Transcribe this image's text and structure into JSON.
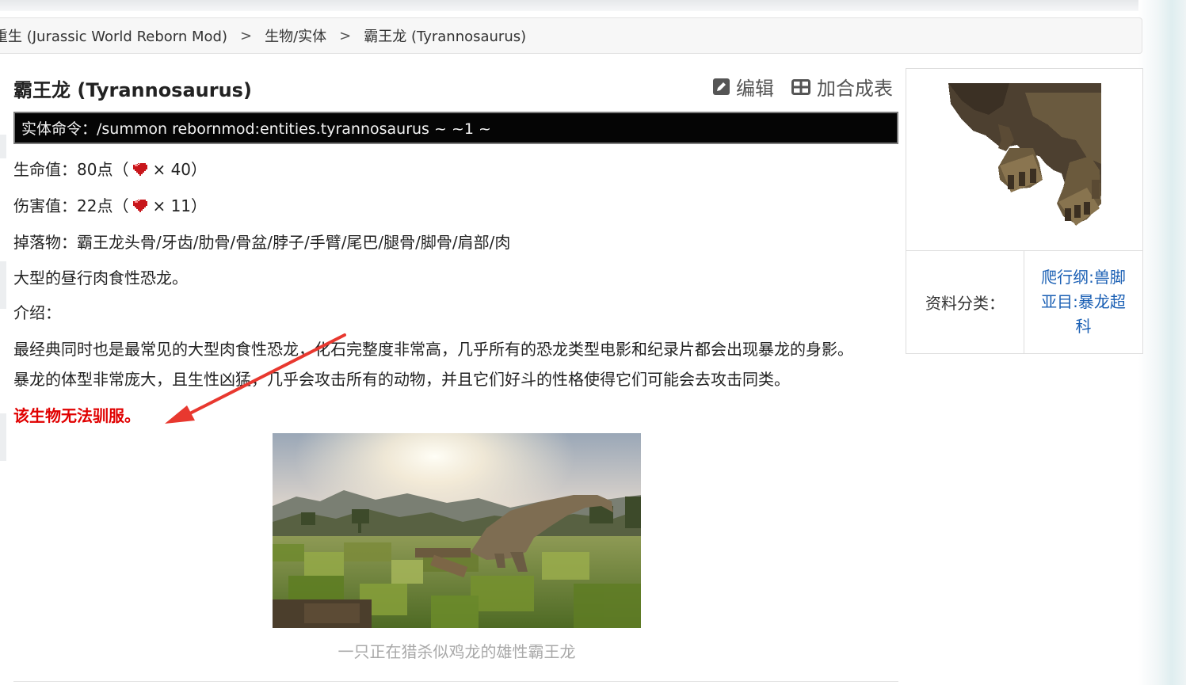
{
  "breadcrumb": {
    "items": [
      "重生 (Jurassic World Reborn Mod)",
      "生物/实体",
      "霸王龙 (Tyrannosaurus)"
    ],
    "separator": ">"
  },
  "page": {
    "title": "霸王龙 (Tyrannosaurus)",
    "actions": {
      "edit": "编辑",
      "recipe": "加合成表"
    }
  },
  "entity": {
    "command": "实体命令：/summon rebornmod:entities.tyrannosaurus ~ ~1 ~",
    "health": {
      "prefix": "生命值：80点（",
      "suffix": "× 40）"
    },
    "damage": {
      "prefix": "伤害值：22点（",
      "suffix": "× 11）"
    },
    "drops": "掉落物：霸王龙头骨/牙齿/肋骨/骨盆/脖子/手臂/尾巴/腿骨/脚骨/肩部/肉",
    "summary": "大型的昼行肉食性恐龙。",
    "intro_label": "介绍：",
    "intro_line1": "最经典同时也是最常见的大型肉食性恐龙，化石完整度非常高，几乎所有的恐龙类型电影和纪录片都会出现暴龙的身影。",
    "intro_line2": "暴龙的体型非常庞大，且生性凶猛，几乎会攻击所有的动物，并且它们好斗的性格使得它们可能会去攻击同类。",
    "tame_note": "该生物无法驯服。"
  },
  "figure": {
    "caption": "一只正在猎杀似鸡龙的雄性霸王龙"
  },
  "infobox": {
    "label": "资料分类：",
    "value": "爬行纲:兽脚亚目:暴龙超科"
  },
  "colors": {
    "accent_red": "#e00000",
    "link_blue": "#1a5fb4",
    "command_bg": "#050505"
  }
}
